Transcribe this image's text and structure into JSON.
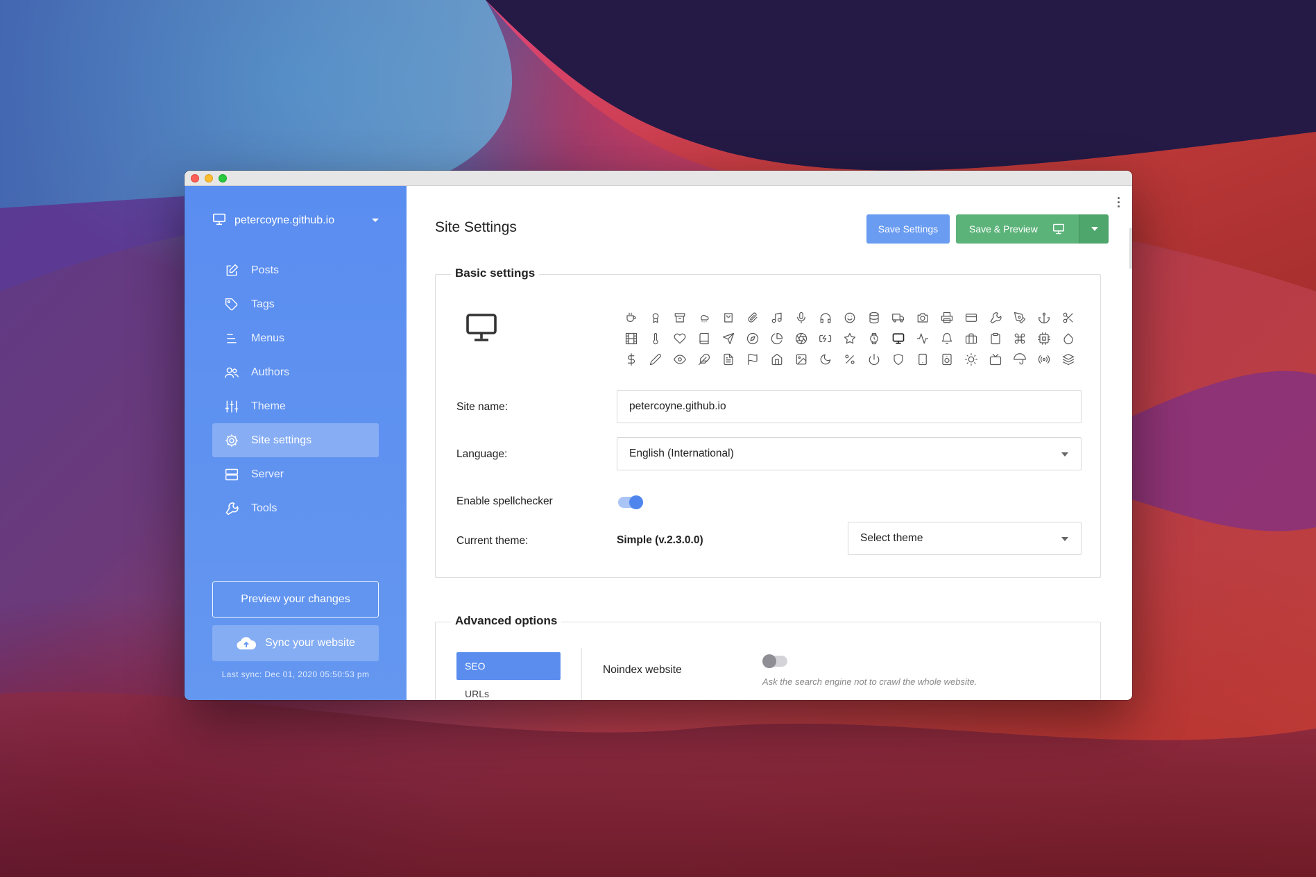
{
  "sidebar": {
    "site_name": "petercoyne.github.io",
    "items": [
      {
        "label": "Posts",
        "icon": "edit-icon"
      },
      {
        "label": "Tags",
        "icon": "tag-icon"
      },
      {
        "label": "Menus",
        "icon": "menu-icon"
      },
      {
        "label": "Authors",
        "icon": "users-icon"
      },
      {
        "label": "Theme",
        "icon": "sliders-icon"
      },
      {
        "label": "Site settings",
        "icon": "gear-icon",
        "active": true
      },
      {
        "label": "Server",
        "icon": "server-icon"
      },
      {
        "label": "Tools",
        "icon": "wrench-icon"
      }
    ],
    "preview_label": "Preview your changes",
    "sync_label": "Sync your website",
    "last_sync": "Last sync: Dec 01, 2020 05:50:53 pm",
    "bg_color": "#5a8df0"
  },
  "main": {
    "title": "Site Settings",
    "save_label": "Save Settings",
    "save_preview_label": "Save & Preview",
    "basic": {
      "legend": "Basic settings",
      "selected_icon": "monitor-icon",
      "site_name_label": "Site name:",
      "site_name_value": "petercoyne.github.io",
      "language_label": "Language:",
      "language_value": "English (International)",
      "spellcheck_label": "Enable spellchecker",
      "spellcheck_on": true,
      "theme_label": "Current theme:",
      "theme_value": "Simple (v.2.3.0.0)",
      "select_theme": "Select theme"
    },
    "advanced": {
      "legend": "Advanced options",
      "tabs": [
        "SEO",
        "URLs"
      ],
      "noindex_label": "Noindex website",
      "noindex_on": false,
      "noindex_help": "Ask the search engine not to crawl the whole website."
    }
  },
  "colors": {
    "primary": "#6a9cf2",
    "success": "#5cb37a",
    "accent": "#4f86ee"
  }
}
